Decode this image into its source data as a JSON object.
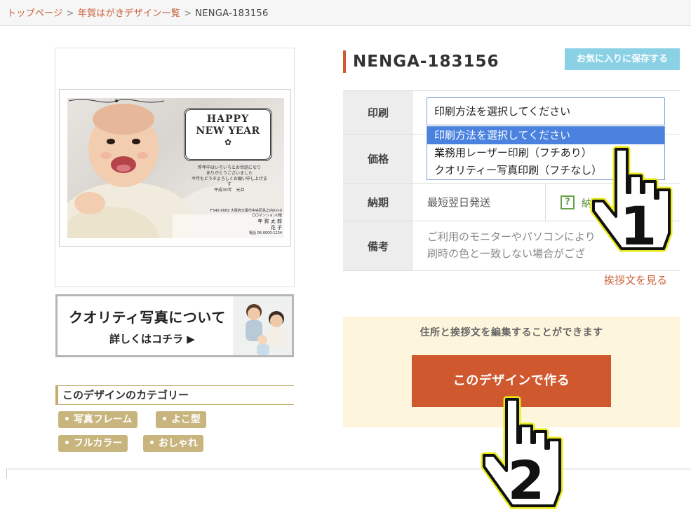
{
  "breadcrumb": {
    "home": "トップページ",
    "sep": ">",
    "list": "年賀はがきデザイン一覧",
    "current": "NENGA-183156"
  },
  "postcard": {
    "hny_line1": "HAPPY",
    "hny_line2": "NEW YEAR",
    "greeting": [
      "昨年中はいろいろとお世話になり",
      "ありがとうございました",
      "今年もどうぞよろしくお願い申し上げます",
      "平成30年　元旦"
    ],
    "address": [
      "〒542-0082 大阪府大阪市中央区島之内0-0-0",
      "〇〇マンション0階",
      "年 賀 太 郎",
      "花 子",
      "電話 06-0000-1234"
    ]
  },
  "banner": {
    "line1": "クオリティ写真について",
    "line2": "詳しくはコチラ ▶"
  },
  "category": {
    "heading": "このデザインのカテゴリー",
    "tags": [
      "写真フレーム",
      "よこ型",
      "フルカラー",
      "おしゃれ"
    ]
  },
  "product": {
    "title": "NENGA-183156",
    "fav_button": "お気に入りに保存する"
  },
  "spec": {
    "print_label": "印刷",
    "select_value": "印刷方法を選択してください",
    "options": [
      "印刷方法を選択してください",
      "業務用レーザー印刷（フチあり）",
      "クオリティー写真印刷（フチなし）"
    ],
    "price_label": "価格",
    "delivery_label": "納期",
    "delivery_value": "最短翌日発送",
    "help_mark": "?",
    "help_text": "納",
    "note_label": "備考",
    "note_lines": [
      "ご利用のモニターやパソコンにより",
      "刷時の色と一致しない場合がござ"
    ]
  },
  "greeting_link": "挨拶文を見る",
  "edit": {
    "message": "住所と挨拶文を編集することができます",
    "button": "このデザインで作る"
  },
  "pointers": {
    "first": "1",
    "second": "2"
  },
  "colors": {
    "accent": "#d0582e",
    "link": "#c8603a",
    "fav": "#8ad1e6",
    "tag": "#c8b57e",
    "panel": "#fdf5dc",
    "dropdown_selected": "#4b82e0"
  }
}
